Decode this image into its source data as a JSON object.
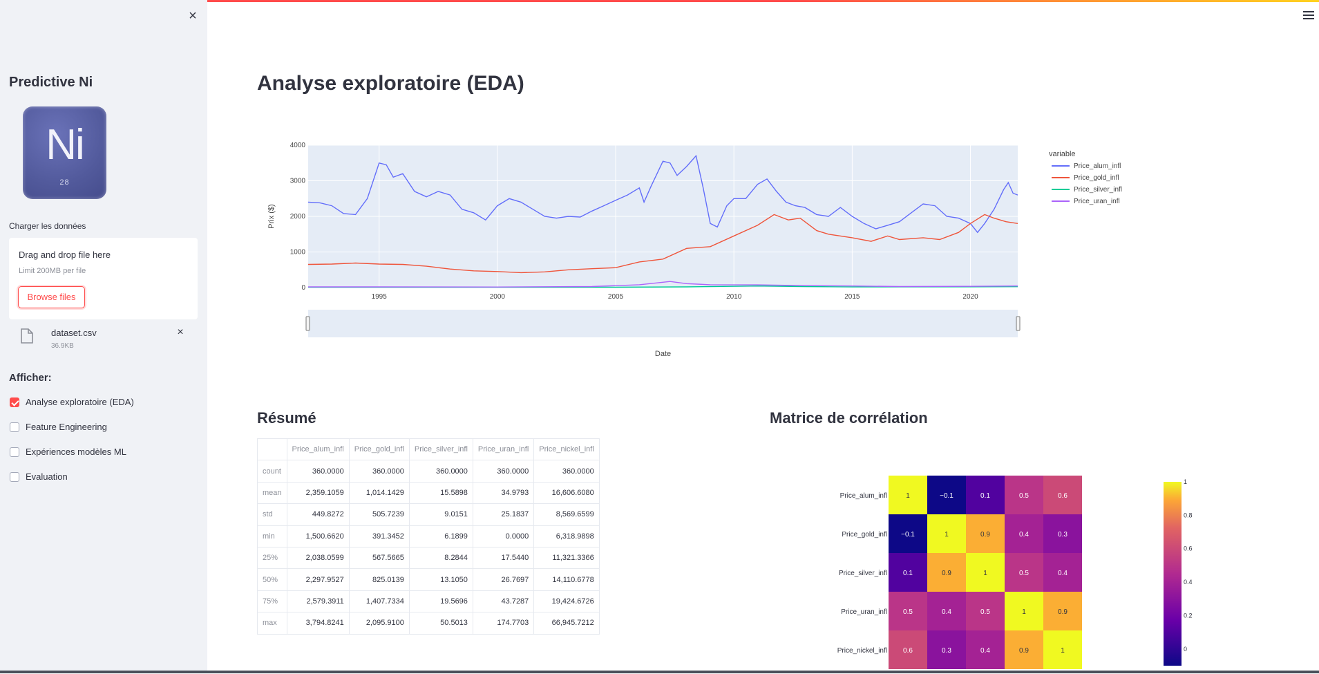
{
  "sidebar": {
    "close_symbol": "×",
    "app_title": "Predictive Ni",
    "logo": {
      "symbol": "Ni",
      "number": "28"
    },
    "upload": {
      "label": "Charger les données",
      "drop_text": "Drag and drop file here",
      "limit_text": "Limit 200MB per file",
      "browse_label": "Browse files"
    },
    "file": {
      "name": "dataset.csv",
      "size": "36.9KB",
      "remove_symbol": "×"
    },
    "show_label": "Afficher:",
    "options": [
      {
        "label": "Analyse exploratoire (EDA)",
        "checked": true
      },
      {
        "label": "Feature Engineering",
        "checked": false
      },
      {
        "label": "Expériences modèles ML",
        "checked": false
      },
      {
        "label": "Evaluation",
        "checked": false
      }
    ]
  },
  "main": {
    "title": "Analyse exploratoire (EDA)",
    "summary_title": "Résumé",
    "corr_title": "Matrice de corrélation"
  },
  "colors": {
    "accent": "#ff4b4b",
    "plot_bg": "#e5ecf6"
  },
  "chart_data": [
    {
      "type": "line",
      "xlabel": "Date",
      "ylabel": "Prix ($)",
      "xlim": [
        1992,
        2022
      ],
      "ylim": [
        0,
        4000
      ],
      "xticks": [
        1995,
        2000,
        2005,
        2010,
        2015,
        2020
      ],
      "yticks": [
        0,
        1000,
        2000,
        3000,
        4000
      ],
      "legend_title": "variable",
      "legend_position": "right",
      "has_range_slider": true,
      "series": [
        {
          "name": "Price_alum_infl",
          "color": "#636efa",
          "points": [
            [
              1992.0,
              2400
            ],
            [
              1992.5,
              2380
            ],
            [
              1993.0,
              2300
            ],
            [
              1993.5,
              2080
            ],
            [
              1994.0,
              2050
            ],
            [
              1994.5,
              2500
            ],
            [
              1995.0,
              3500
            ],
            [
              1995.3,
              3450
            ],
            [
              1995.6,
              3100
            ],
            [
              1996.0,
              3200
            ],
            [
              1996.5,
              2700
            ],
            [
              1997.0,
              2550
            ],
            [
              1997.5,
              2700
            ],
            [
              1998.0,
              2600
            ],
            [
              1998.5,
              2200
            ],
            [
              1999.0,
              2100
            ],
            [
              1999.5,
              1900
            ],
            [
              2000.0,
              2300
            ],
            [
              2000.5,
              2500
            ],
            [
              2001.0,
              2400
            ],
            [
              2001.5,
              2200
            ],
            [
              2002.0,
              2000
            ],
            [
              2002.5,
              1950
            ],
            [
              2003.0,
              2000
            ],
            [
              2003.5,
              1980
            ],
            [
              2004.0,
              2150
            ],
            [
              2004.5,
              2300
            ],
            [
              2005.0,
              2450
            ],
            [
              2005.5,
              2600
            ],
            [
              2006.0,
              2800
            ],
            [
              2006.2,
              2400
            ],
            [
              2006.5,
              2850
            ],
            [
              2007.0,
              3550
            ],
            [
              2007.3,
              3500
            ],
            [
              2007.6,
              3150
            ],
            [
              2008.0,
              3400
            ],
            [
              2008.4,
              3700
            ],
            [
              2008.7,
              2800
            ],
            [
              2009.0,
              1800
            ],
            [
              2009.3,
              1700
            ],
            [
              2009.7,
              2300
            ],
            [
              2010.0,
              2500
            ],
            [
              2010.5,
              2500
            ],
            [
              2011.0,
              2900
            ],
            [
              2011.4,
              3050
            ],
            [
              2011.8,
              2700
            ],
            [
              2012.2,
              2400
            ],
            [
              2012.6,
              2300
            ],
            [
              2013.0,
              2250
            ],
            [
              2013.5,
              2050
            ],
            [
              2014.0,
              2000
            ],
            [
              2014.5,
              2250
            ],
            [
              2015.0,
              2000
            ],
            [
              2015.5,
              1800
            ],
            [
              2016.0,
              1650
            ],
            [
              2016.5,
              1750
            ],
            [
              2017.0,
              1850
            ],
            [
              2017.5,
              2100
            ],
            [
              2018.0,
              2350
            ],
            [
              2018.5,
              2300
            ],
            [
              2019.0,
              2000
            ],
            [
              2019.5,
              1950
            ],
            [
              2020.0,
              1800
            ],
            [
              2020.3,
              1550
            ],
            [
              2020.6,
              1800
            ],
            [
              2021.0,
              2200
            ],
            [
              2021.4,
              2750
            ],
            [
              2021.6,
              2950
            ],
            [
              2021.8,
              2650
            ],
            [
              2022.0,
              2600
            ]
          ]
        },
        {
          "name": "Price_gold_infl",
          "color": "#ef553b",
          "points": [
            [
              1992.0,
              650
            ],
            [
              1993.0,
              660
            ],
            [
              1994.0,
              690
            ],
            [
              1995.0,
              660
            ],
            [
              1996.0,
              650
            ],
            [
              1997.0,
              600
            ],
            [
              1998.0,
              520
            ],
            [
              1999.0,
              470
            ],
            [
              2000.0,
              450
            ],
            [
              2001.0,
              420
            ],
            [
              2002.0,
              440
            ],
            [
              2003.0,
              500
            ],
            [
              2004.0,
              530
            ],
            [
              2005.0,
              560
            ],
            [
              2006.0,
              720
            ],
            [
              2007.0,
              800
            ],
            [
              2008.0,
              1100
            ],
            [
              2009.0,
              1150
            ],
            [
              2010.0,
              1450
            ],
            [
              2011.0,
              1750
            ],
            [
              2011.7,
              2050
            ],
            [
              2012.3,
              1900
            ],
            [
              2012.8,
              1950
            ],
            [
              2013.5,
              1600
            ],
            [
              2014.0,
              1500
            ],
            [
              2015.0,
              1400
            ],
            [
              2015.8,
              1300
            ],
            [
              2016.5,
              1450
            ],
            [
              2017.0,
              1350
            ],
            [
              2018.0,
              1400
            ],
            [
              2018.7,
              1350
            ],
            [
              2019.5,
              1550
            ],
            [
              2020.0,
              1800
            ],
            [
              2020.6,
              2050
            ],
            [
              2021.0,
              1950
            ],
            [
              2021.5,
              1850
            ],
            [
              2022.0,
              1800
            ]
          ]
        },
        {
          "name": "Price_silver_infl",
          "color": "#00cc96",
          "points": [
            [
              1992,
              8
            ],
            [
              1995,
              9
            ],
            [
              2000,
              7
            ],
            [
              2005,
              10
            ],
            [
              2008,
              20
            ],
            [
              2011,
              45
            ],
            [
              2013,
              30
            ],
            [
              2015,
              18
            ],
            [
              2020,
              22
            ],
            [
              2022,
              25
            ]
          ]
        },
        {
          "name": "Price_uran_infl",
          "color": "#ab63fa",
          "points": [
            [
              1992,
              20
            ],
            [
              1995,
              20
            ],
            [
              2000,
              15
            ],
            [
              2004,
              30
            ],
            [
              2006,
              80
            ],
            [
              2007.3,
              170
            ],
            [
              2008,
              110
            ],
            [
              2009,
              80
            ],
            [
              2011,
              75
            ],
            [
              2013,
              55
            ],
            [
              2015,
              45
            ],
            [
              2017,
              30
            ],
            [
              2020,
              35
            ],
            [
              2022,
              45
            ]
          ]
        }
      ]
    },
    {
      "type": "heatmap",
      "labels": [
        "Price_alum_infl",
        "Price_gold_infl",
        "Price_silver_infl",
        "Price_uran_infl",
        "Price_nickel_infl"
      ],
      "values": [
        [
          1,
          -0.1,
          0.1,
          0.5,
          0.6
        ],
        [
          -0.1,
          1,
          0.9,
          0.4,
          0.3
        ],
        [
          0.1,
          0.9,
          1,
          0.5,
          0.4
        ],
        [
          0.5,
          0.4,
          0.5,
          1,
          0.9
        ],
        [
          0.6,
          0.3,
          0.4,
          0.9,
          1
        ]
      ],
      "value_labels": [
        [
          "1",
          "−0.1",
          "0.1",
          "0.5",
          "0.6"
        ],
        [
          "−0.1",
          "1",
          "0.9",
          "0.4",
          "0.3"
        ],
        [
          "0.1",
          "0.9",
          "1",
          "0.5",
          "0.4"
        ],
        [
          "0.5",
          "0.4",
          "0.5",
          "1",
          "0.9"
        ],
        [
          "0.6",
          "0.3",
          "0.4",
          "0.9",
          "1"
        ]
      ],
      "colorscale": "plasma",
      "colorbar_ticks": [
        "0",
        "0.2",
        "0.4",
        "0.6",
        "0.8",
        "1"
      ],
      "colorbar_range": [
        -0.1,
        1
      ]
    },
    {
      "type": "table",
      "columns": [
        "",
        "Price_alum_infl",
        "Price_gold_infl",
        "Price_silver_infl",
        "Price_uran_infl",
        "Price_nickel_infl"
      ],
      "rows": [
        [
          "count",
          "360.0000",
          "360.0000",
          "360.0000",
          "360.0000",
          "360.0000"
        ],
        [
          "mean",
          "2,359.1059",
          "1,014.1429",
          "15.5898",
          "34.9793",
          "16,606.6080"
        ],
        [
          "std",
          "449.8272",
          "505.7239",
          "9.0151",
          "25.1837",
          "8,569.6599"
        ],
        [
          "min",
          "1,500.6620",
          "391.3452",
          "6.1899",
          "0.0000",
          "6,318.9898"
        ],
        [
          "25%",
          "2,038.0599",
          "567.5665",
          "8.2844",
          "17.5440",
          "11,321.3366"
        ],
        [
          "50%",
          "2,297.9527",
          "825.0139",
          "13.1050",
          "26.7697",
          "14,110.6778"
        ],
        [
          "75%",
          "2,579.3911",
          "1,407.7334",
          "19.5696",
          "43.7287",
          "19,424.6726"
        ],
        [
          "max",
          "3,794.8241",
          "2,095.9100",
          "50.5013",
          "174.7703",
          "66,945.7212"
        ]
      ]
    }
  ]
}
